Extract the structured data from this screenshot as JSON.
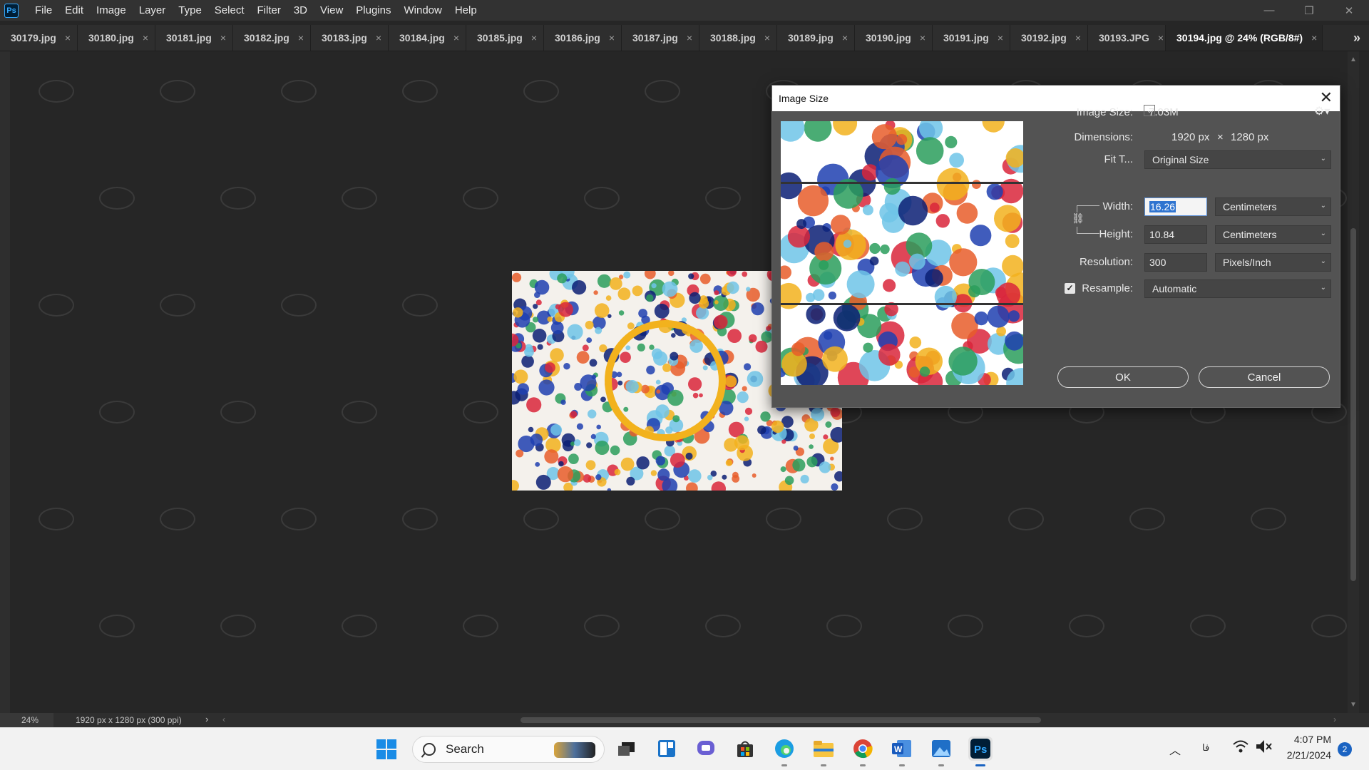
{
  "app": {
    "logo": "Ps"
  },
  "menu": [
    "File",
    "Edit",
    "Image",
    "Layer",
    "Type",
    "Select",
    "Filter",
    "3D",
    "View",
    "Plugins",
    "Window",
    "Help"
  ],
  "window_controls": {
    "minimize": "—",
    "restore": "❐",
    "close": "✕"
  },
  "tabs": [
    {
      "label": "30179.jpg",
      "active": false
    },
    {
      "label": "30180.jpg",
      "active": false
    },
    {
      "label": "30181.jpg",
      "active": false
    },
    {
      "label": "30182.jpg",
      "active": false
    },
    {
      "label": "30183.jpg",
      "active": false
    },
    {
      "label": "30184.jpg",
      "active": false
    },
    {
      "label": "30185.jpg",
      "active": false
    },
    {
      "label": "30186.jpg",
      "active": false
    },
    {
      "label": "30187.jpg",
      "active": false
    },
    {
      "label": "30188.jpg",
      "active": false
    },
    {
      "label": "30189.jpg",
      "active": false
    },
    {
      "label": "30190.jpg",
      "active": false
    },
    {
      "label": "30191.jpg",
      "active": false
    },
    {
      "label": "30192.jpg",
      "active": false
    },
    {
      "label": "30193.JPG",
      "active": false
    },
    {
      "label": "30194.jpg @ 24% (RGB/8#)",
      "active": true
    }
  ],
  "tab_close_glyph": "×",
  "tab_overflow": "»",
  "status": {
    "zoom": "24%",
    "doc_info": "1920 px x 1280 px (300 ppi)",
    "arrow": "›"
  },
  "dialog": {
    "title": "Image Size",
    "close": "✕",
    "image_size_label": "Image Size:",
    "image_size_value": "7.03M",
    "dimensions_label": "Dimensions:",
    "dim_w": "1920 px",
    "dim_x": "×",
    "dim_h": "1280 px",
    "fit_label": "Fit T...",
    "fit_value": "Original Size",
    "width_label": "Width:",
    "width_value": "16.26",
    "width_unit": "Centimeters",
    "height_label": "Height:",
    "height_value": "10.84",
    "height_unit": "Centimeters",
    "resolution_label": "Resolution:",
    "resolution_value": "300",
    "resolution_unit": "Pixels/Inch",
    "resample_label": "Resample:",
    "resample_checked": true,
    "resample_value": "Automatic",
    "ok_label": "OK",
    "cancel_label": "Cancel"
  },
  "taskbar": {
    "search_label": "Search",
    "lang": "فا",
    "time": "4:07 PM",
    "date": "2/21/2024",
    "notifications": "2",
    "ps_label": "Ps"
  },
  "colors": {
    "accent": "#31a8ff",
    "selection": "#2f74d0"
  }
}
